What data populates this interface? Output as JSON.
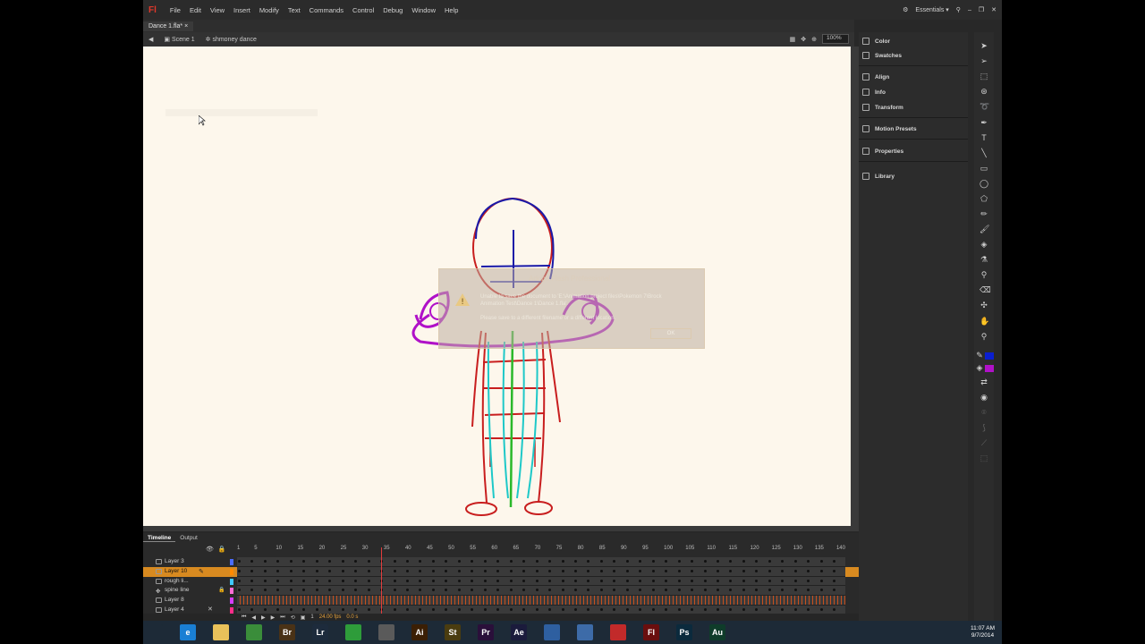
{
  "app": {
    "logo": "Fl",
    "menus": [
      "File",
      "Edit",
      "View",
      "Insert",
      "Modify",
      "Text",
      "Commands",
      "Control",
      "Debug",
      "Window",
      "Help"
    ],
    "workspace": "Essentials",
    "workspace_dropdown": "▾"
  },
  "document": {
    "tab": "Dance 1.fla*",
    "tab_close": "×",
    "scene": "Scene 1",
    "symbol": "shmoney dance",
    "zoom": "100%"
  },
  "dialog": {
    "title": "Adobe Flash Professional",
    "message": "Unable to save the document to 'E:\\Animation project files\\Pokemon 7\\Brock Animation Test\\Dance 1\\Dance 1.fla'.",
    "sub": "Please save to a different filename or a different location.",
    "ok": "OK"
  },
  "timeline": {
    "tabs": [
      "Timeline",
      "Output"
    ],
    "ruler": [
      "1",
      "5",
      "10",
      "15",
      "20",
      "25",
      "30",
      "35",
      "40",
      "45",
      "50",
      "55",
      "60",
      "65",
      "70",
      "75",
      "80",
      "85",
      "90",
      "95",
      "100",
      "105",
      "110",
      "115",
      "120",
      "125",
      "130",
      "135",
      "140"
    ],
    "layers": [
      {
        "name": "Layer 3",
        "color": "#4a6cff",
        "active": false
      },
      {
        "name": "Layer 10",
        "color": "#ff8a00",
        "active": true
      },
      {
        "name": "rough li...",
        "color": "#3ec8ff",
        "active": false
      },
      {
        "name": "spine line",
        "color": "#ff6bd6",
        "active": false
      },
      {
        "name": "Layer 8",
        "color": "#d63cff",
        "active": false
      },
      {
        "name": "Layer 4",
        "color": "#ff2d8a",
        "active": false
      }
    ],
    "current_frame": "1",
    "fps": "24.00 fps",
    "time": "0.0 s"
  },
  "panels": [
    "Color",
    "Swatches",
    "Align",
    "Info",
    "Transform",
    "Motion Presets",
    "Properties",
    "Library"
  ],
  "colors": {
    "stroke": "#0b1fd0",
    "fill": "#b011c8"
  },
  "taskbar": {
    "apps": [
      {
        "name": "windows-start",
        "label": "",
        "color": "#1d2a37"
      },
      {
        "name": "internet-explorer",
        "label": "e",
        "color": "#1a7fd4"
      },
      {
        "name": "file-explorer",
        "label": "",
        "color": "#e8c15a"
      },
      {
        "name": "chrome",
        "label": "",
        "color": "#3a8d3a"
      },
      {
        "name": "bridge",
        "label": "Br",
        "color": "#4a3216"
      },
      {
        "name": "lightroom",
        "label": "Lr",
        "color": "#1d2b3c"
      },
      {
        "name": "store",
        "label": "",
        "color": "#2e9c3a"
      },
      {
        "name": "paint-tool",
        "label": "",
        "color": "#5a5a5a"
      },
      {
        "name": "illustrator",
        "label": "Ai",
        "color": "#3b1f05"
      },
      {
        "name": "story",
        "label": "St",
        "color": "#4a3c10"
      },
      {
        "name": "premiere",
        "label": "Pr",
        "color": "#2a0f3a"
      },
      {
        "name": "after-effects",
        "label": "Ae",
        "color": "#1b1b3c"
      },
      {
        "name": "video-app",
        "label": "",
        "color": "#2e5fa0"
      },
      {
        "name": "media-app",
        "label": "",
        "color": "#3d6ba8"
      },
      {
        "name": "quill-app",
        "label": "",
        "color": "#c22a2a"
      },
      {
        "name": "flash",
        "label": "Fl",
        "color": "#6a0e0e"
      },
      {
        "name": "photoshop",
        "label": "Ps",
        "color": "#0b2a3d"
      },
      {
        "name": "audition",
        "label": "Au",
        "color": "#0f3c2a"
      }
    ],
    "time": "11:07 AM",
    "date": "9/7/2014"
  }
}
